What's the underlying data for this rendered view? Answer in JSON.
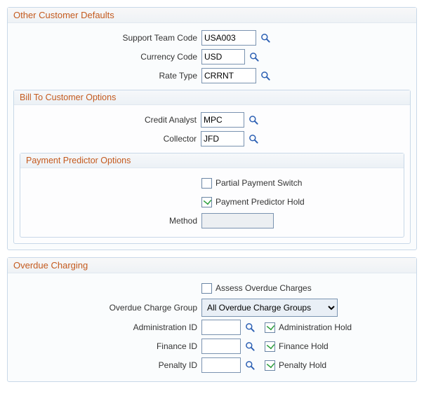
{
  "section_other": {
    "title": "Other Customer Defaults",
    "support_team_code": {
      "label": "Support Team Code",
      "value": "USA003"
    },
    "currency_code": {
      "label": "Currency Code",
      "value": "USD"
    },
    "rate_type": {
      "label": "Rate Type",
      "value": "CRRNT"
    }
  },
  "section_billto": {
    "title": "Bill To Customer Options",
    "credit_analyst": {
      "label": "Credit Analyst",
      "value": "MPC"
    },
    "collector": {
      "label": "Collector",
      "value": "JFD"
    }
  },
  "section_pp": {
    "title": "Payment Predictor Options",
    "partial_switch": {
      "label": "Partial Payment Switch",
      "checked": false
    },
    "predictor_hold": {
      "label": "Payment Predictor Hold",
      "checked": true
    },
    "method": {
      "label": "Method",
      "value": ""
    }
  },
  "section_overdue": {
    "title": "Overdue Charging",
    "assess": {
      "label": "Assess Overdue Charges",
      "checked": false
    },
    "group": {
      "label": "Overdue Charge Group",
      "selected": "All Overdue Charge Groups"
    },
    "admin": {
      "label": "Administration ID",
      "value": "",
      "hold_label": "Administration Hold",
      "hold_checked": true
    },
    "finance": {
      "label": "Finance ID",
      "value": "",
      "hold_label": "Finance Hold",
      "hold_checked": true
    },
    "penalty": {
      "label": "Penalty ID",
      "value": "",
      "hold_label": "Penalty Hold",
      "hold_checked": true
    }
  }
}
